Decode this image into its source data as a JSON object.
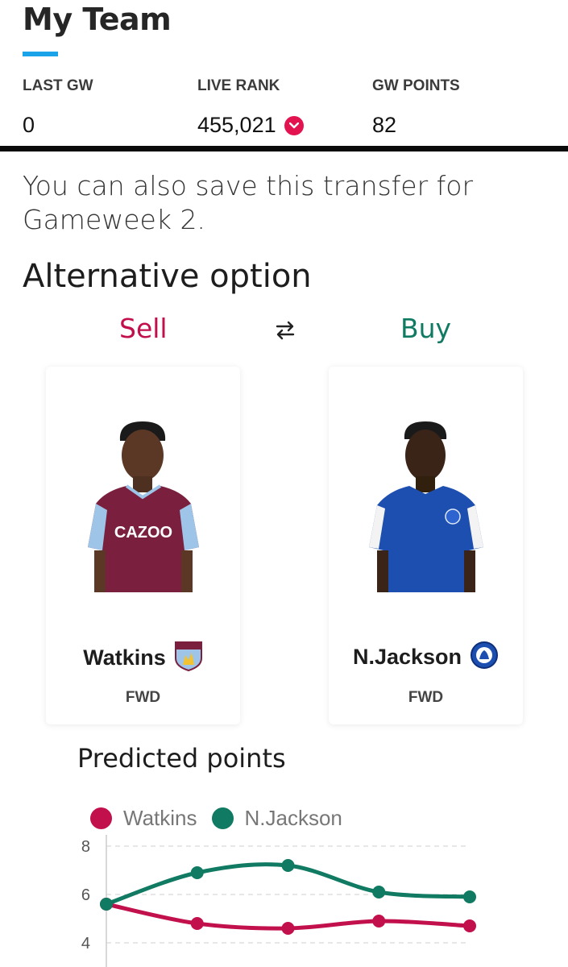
{
  "header": {
    "title": "My Team"
  },
  "stats": [
    {
      "label": "LAST GW",
      "value": "0"
    },
    {
      "label": "LIVE RANK",
      "value": "455,021",
      "trend": "down"
    },
    {
      "label": "GW POINTS",
      "value": "82"
    }
  ],
  "save_text": "You can also save this transfer for Gameweek 2.",
  "alternative_title": "Alternative option",
  "sell_label": "Sell",
  "buy_label": "Buy",
  "sell_player": {
    "name": "Watkins",
    "position": "FWD",
    "club_badge": "aston-villa-badge-icon",
    "kit_color": "#7a1f3d"
  },
  "buy_player": {
    "name": "N.Jackson",
    "position": "FWD",
    "club_badge": "chelsea-badge-icon",
    "kit_color": "#1c4fb0"
  },
  "colors": {
    "accent": "#1aa3e8",
    "sell": "#c2104d",
    "buy": "#107a63",
    "rank_down": "#e3134f"
  },
  "predicted_points_title": "Predicted points",
  "chart_data": {
    "type": "line",
    "x": [
      1,
      2,
      3,
      4,
      5
    ],
    "series": [
      {
        "name": "Watkins",
        "color": "#c2104d",
        "values": [
          5.6,
          4.8,
          4.6,
          4.9,
          4.7
        ]
      },
      {
        "name": "N.Jackson",
        "color": "#107a63",
        "values": [
          5.6,
          6.9,
          7.2,
          6.1,
          5.9
        ]
      }
    ],
    "yticks": [
      8,
      6,
      4
    ],
    "ylim": [
      4,
      8
    ],
    "grid": true,
    "legend": "top-left"
  }
}
